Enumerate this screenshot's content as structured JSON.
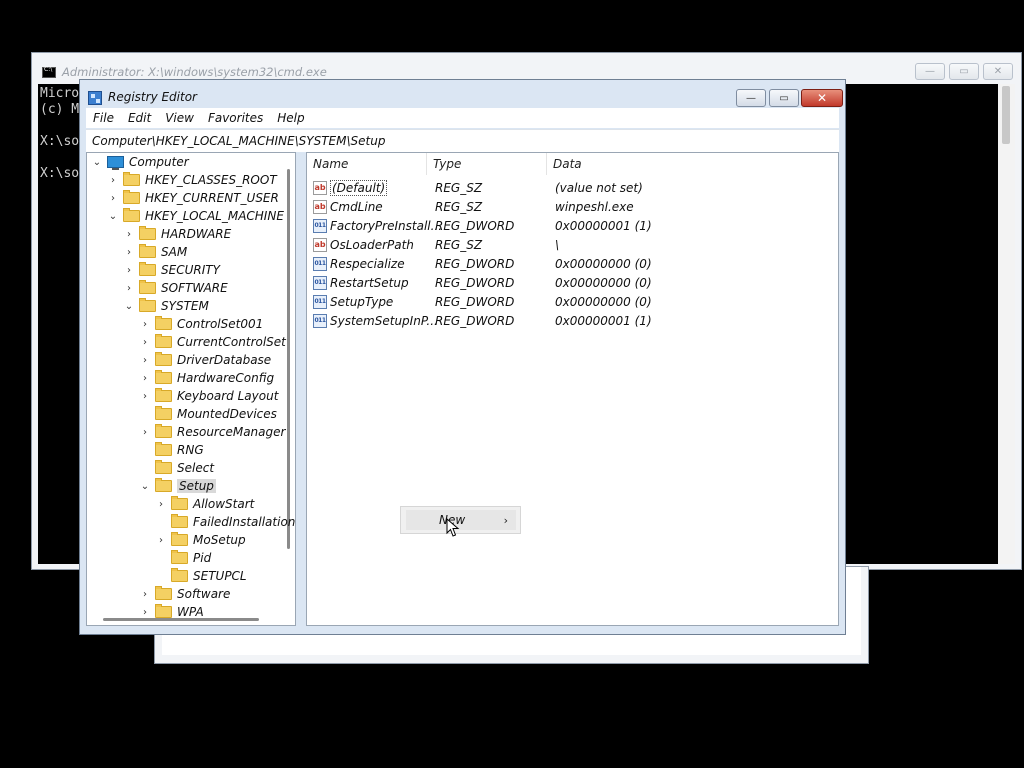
{
  "cmd": {
    "title": "Administrator: X:\\windows\\system32\\cmd.exe",
    "minimize": "—",
    "maximize": "▭",
    "close": "✕",
    "console_lines": [
      "Micro",
      "(c) M",
      "",
      "X:\\so",
      "",
      "X:\\so"
    ]
  },
  "regedit": {
    "title": "Registry Editor",
    "minimize": "—",
    "maximize": "▭",
    "close": "✕",
    "menu": [
      "File",
      "Edit",
      "View",
      "Favorites",
      "Help"
    ],
    "address": "Computer\\HKEY_LOCAL_MACHINE\\SYSTEM\\Setup",
    "tree": [
      {
        "label": "Computer",
        "chevron": "⌄",
        "icon": "computer-icon"
      },
      {
        "label": "HKEY_CLASSES_ROOT",
        "chevron": "›",
        "icon": "folder-icon"
      },
      {
        "label": "HKEY_CURRENT_USER",
        "chevron": "›",
        "icon": "folder-icon"
      },
      {
        "label": "HKEY_LOCAL_MACHINE",
        "chevron": "⌄",
        "icon": "folder-icon"
      },
      {
        "label": "HARDWARE",
        "chevron": "›",
        "icon": "folder-icon"
      },
      {
        "label": "SAM",
        "chevron": "›",
        "icon": "folder-icon"
      },
      {
        "label": "SECURITY",
        "chevron": "›",
        "icon": "folder-icon"
      },
      {
        "label": "SOFTWARE",
        "chevron": "›",
        "icon": "folder-icon"
      },
      {
        "label": "SYSTEM",
        "chevron": "⌄",
        "icon": "folder-icon"
      },
      {
        "label": "ControlSet001",
        "chevron": "›",
        "icon": "folder-icon"
      },
      {
        "label": "CurrentControlSet",
        "chevron": "›",
        "icon": "folder-icon"
      },
      {
        "label": "DriverDatabase",
        "chevron": "›",
        "icon": "folder-icon"
      },
      {
        "label": "HardwareConfig",
        "chevron": "›",
        "icon": "folder-icon"
      },
      {
        "label": "Keyboard Layout",
        "chevron": "›",
        "icon": "folder-icon"
      },
      {
        "label": "MountedDevices",
        "chevron": "",
        "icon": "folder-icon"
      },
      {
        "label": "ResourceManager",
        "chevron": "›",
        "icon": "folder-icon"
      },
      {
        "label": "RNG",
        "chevron": "",
        "icon": "folder-icon"
      },
      {
        "label": "Select",
        "chevron": "",
        "icon": "folder-icon"
      },
      {
        "label": "Setup",
        "chevron": "⌄",
        "icon": "folder-icon",
        "selected": true
      },
      {
        "label": "AllowStart",
        "chevron": "›",
        "icon": "folder-icon"
      },
      {
        "label": "FailedInstallation",
        "chevron": "",
        "icon": "folder-icon"
      },
      {
        "label": "MoSetup",
        "chevron": "›",
        "icon": "folder-icon"
      },
      {
        "label": "Pid",
        "chevron": "",
        "icon": "folder-icon"
      },
      {
        "label": "SETUPCL",
        "chevron": "",
        "icon": "folder-icon"
      },
      {
        "label": "Software",
        "chevron": "›",
        "icon": "folder-icon"
      },
      {
        "label": "WPA",
        "chevron": "›",
        "icon": "folder-icon"
      }
    ],
    "columns": [
      "Name",
      "Type",
      "Data"
    ],
    "values": [
      {
        "name": "(Default)",
        "type": "REG_SZ",
        "data": "(value not set)",
        "kind": "sz"
      },
      {
        "name": "CmdLine",
        "type": "REG_SZ",
        "data": "winpeshl.exe",
        "kind": "sz"
      },
      {
        "name": "FactoryPreInstall...",
        "type": "REG_DWORD",
        "data": "0x00000001 (1)",
        "kind": "dword"
      },
      {
        "name": "OsLoaderPath",
        "type": "REG_SZ",
        "data": "\\",
        "kind": "sz"
      },
      {
        "name": "Respecialize",
        "type": "REG_DWORD",
        "data": "0x00000000 (0)",
        "kind": "dword"
      },
      {
        "name": "RestartSetup",
        "type": "REG_DWORD",
        "data": "0x00000000 (0)",
        "kind": "dword"
      },
      {
        "name": "SetupType",
        "type": "REG_DWORD",
        "data": "0x00000000 (0)",
        "kind": "dword"
      },
      {
        "name": "SystemSetupInP...",
        "type": "REG_DWORD",
        "data": "0x00000001 (1)",
        "kind": "dword"
      }
    ],
    "icon_text": {
      "sz": "ab",
      "dword": "011"
    },
    "context_menu": {
      "new_label": "New",
      "arrow": "›"
    }
  }
}
